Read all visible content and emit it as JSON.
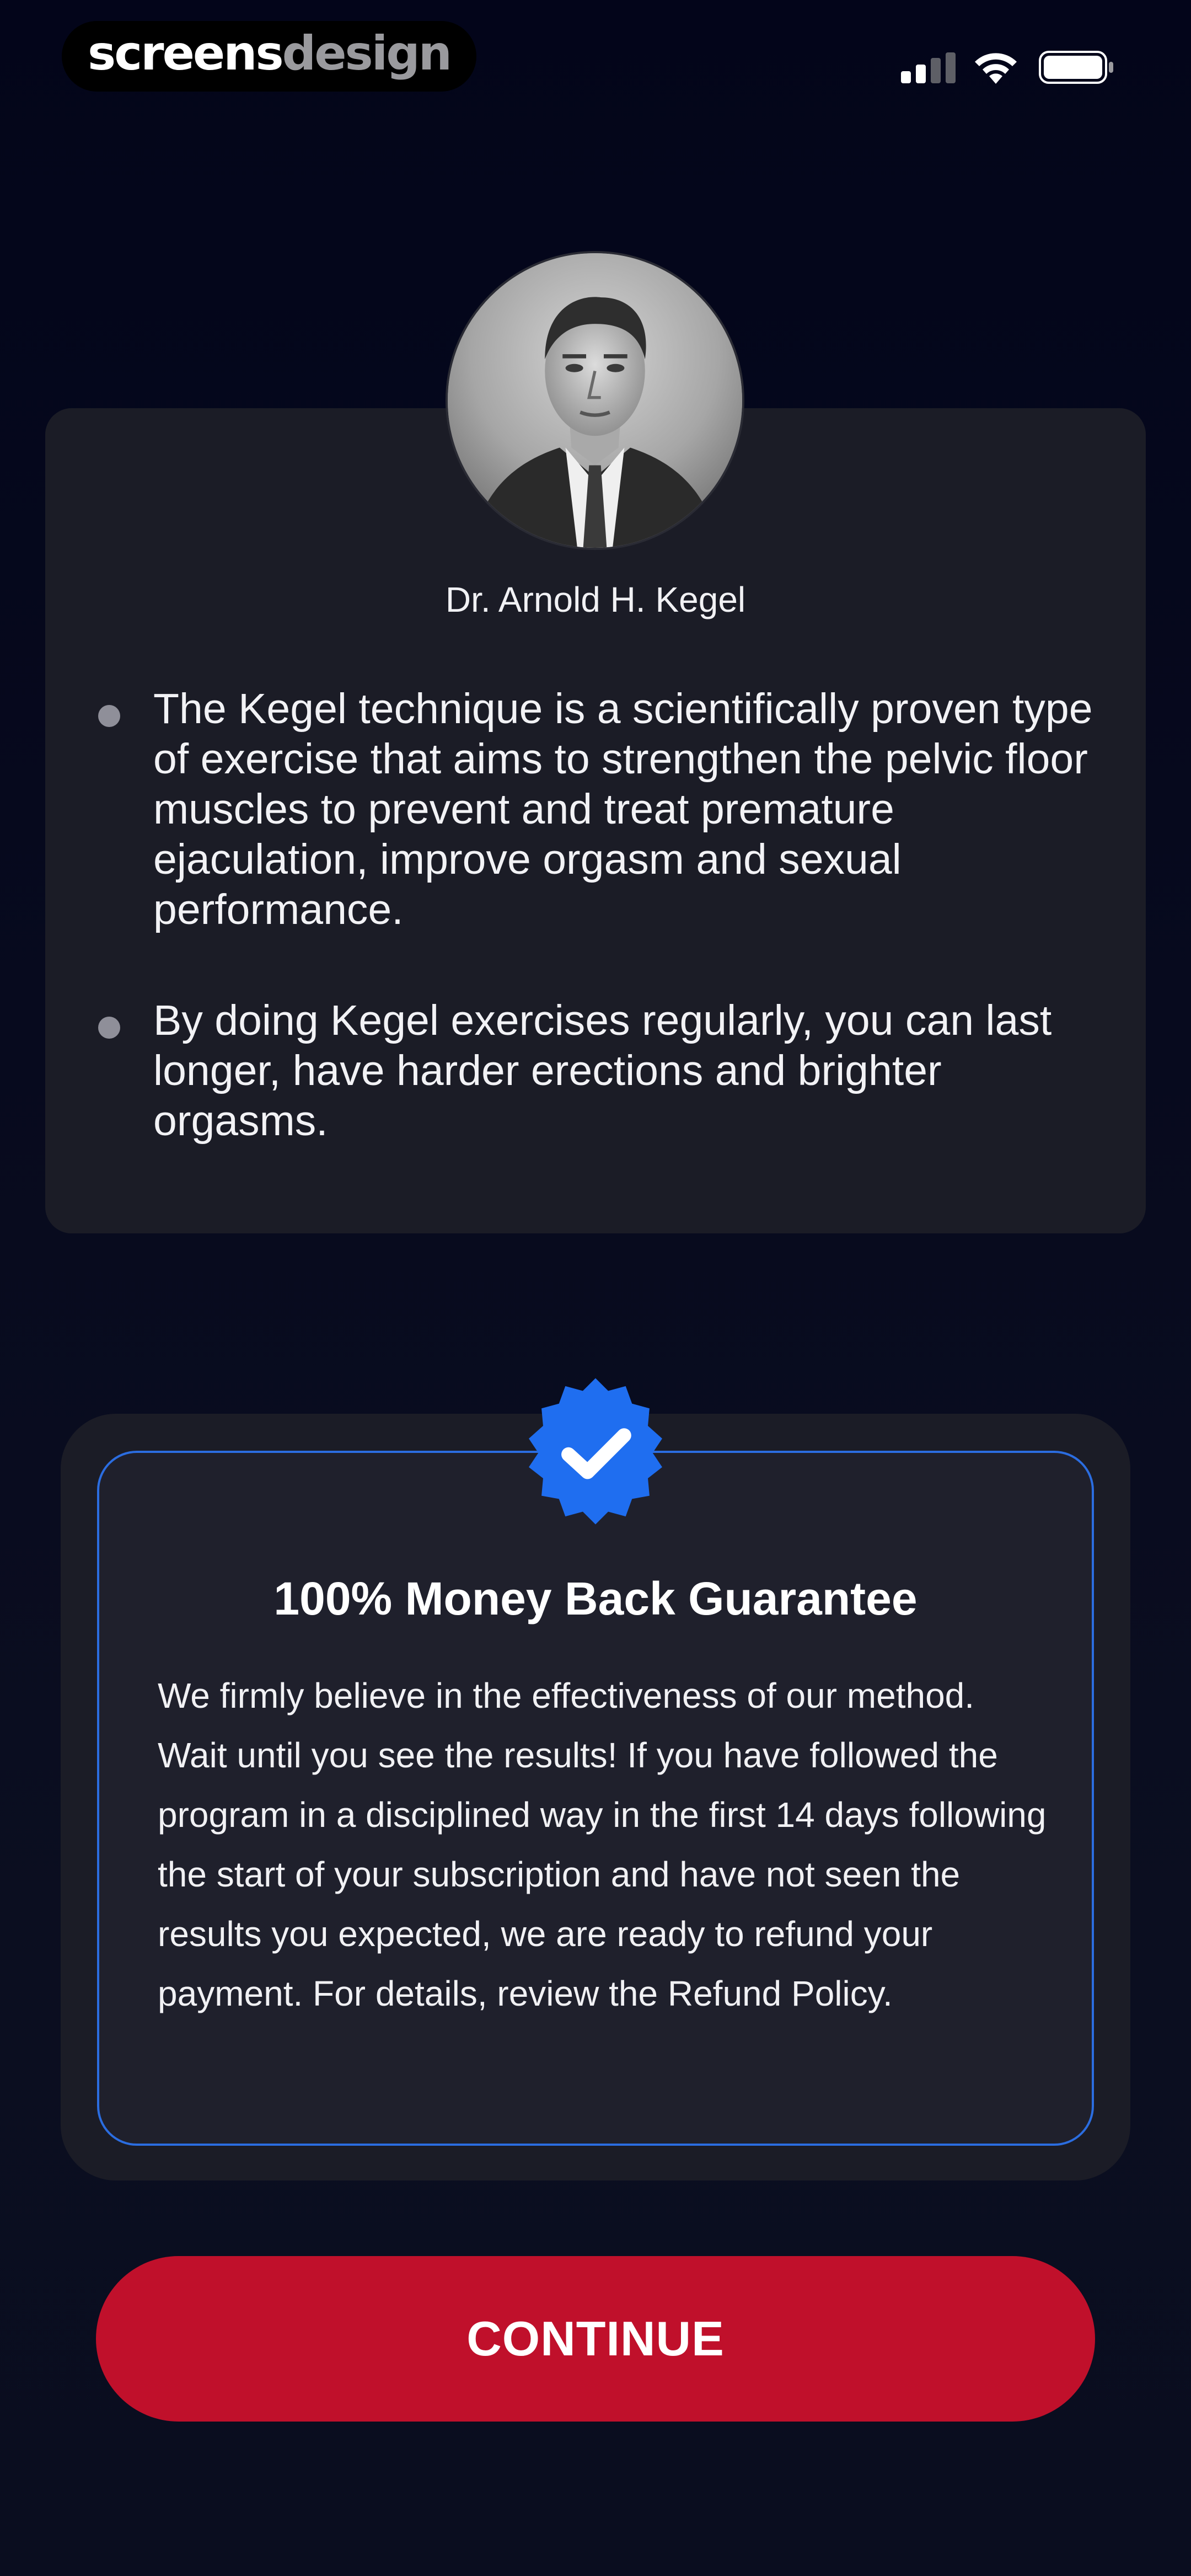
{
  "status_bar": {
    "brand_part1": "screens",
    "brand_part2": "design",
    "icons": [
      "signal-icon",
      "wifi-icon",
      "battery-icon"
    ]
  },
  "info_card": {
    "portrait_icon": "doctor-portrait",
    "doctor_name": "Dr. Arnold H. Kegel",
    "bullets": [
      "The Kegel technique is a scientifically proven type of exercise that aims to strengthen the pelvic floor muscles to prevent and treat premature ejaculation, improve orgasm and sexual performance.",
      "By doing Kegel exercises regularly, you can last longer, have harder erections and brighter orgasms."
    ]
  },
  "guarantee": {
    "badge_icon": "verified-check-icon",
    "title": "100% Money Back Guarantee",
    "body": "We firmly believe in the effectiveness of our method. Wait until you see the results! If you have followed the program in a disciplined way in the first 14 days following the start of your subscription and have not seen the results you expected, we are ready to refund your payment. For details, review the Refund Policy."
  },
  "actions": {
    "continue_label": "CONTINUE"
  },
  "colors": {
    "background": "#05071a",
    "card": "#1b1c26",
    "accent_blue": "#1f6ef0",
    "cta_red": "#c0102b"
  }
}
